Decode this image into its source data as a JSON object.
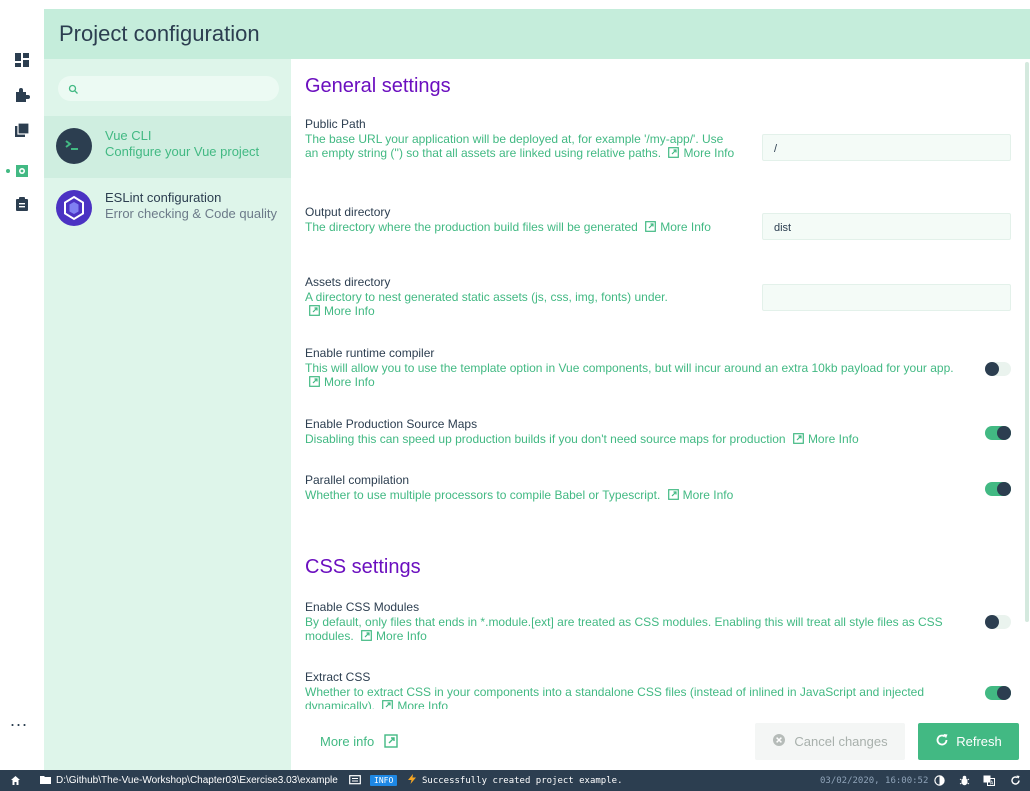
{
  "header": {
    "title": "Project configuration"
  },
  "sidebar": {
    "search": {
      "placeholder": ""
    },
    "items": [
      {
        "name": "Vue CLI",
        "description": "Configure your Vue project",
        "selected": true,
        "icon": "vue-cli-icon"
      },
      {
        "name": "ESLint configuration",
        "description": "Error checking & Code quality",
        "selected": false,
        "icon": "eslint-icon"
      }
    ]
  },
  "nav_rail": {
    "icons": [
      "dashboard-icon",
      "plugins-icon",
      "dependencies-icon",
      "configuration-icon",
      "tasks-icon"
    ],
    "more": "..."
  },
  "general": {
    "title": "General settings",
    "public_path": {
      "label": "Public Path",
      "description": "The base URL your application will be deployed at, for example '/my-app/'. Use an empty string ('') so that all assets are linked using relative paths.",
      "more": "More Info",
      "value": "/"
    },
    "output_dir": {
      "label": "Output directory",
      "description": "The directory where the production build files will be generated",
      "more": "More Info",
      "value": "dist"
    },
    "assets_dir": {
      "label": "Assets directory",
      "description": "A directory to nest generated static assets (js, css, img, fonts) under.",
      "more": "More Info",
      "value": ""
    },
    "runtime_compiler": {
      "label": "Enable runtime compiler",
      "description": "This will allow you to use the template option in Vue components, but will incur around an extra 10kb payload for your app.",
      "more": "More Info",
      "enabled": false
    },
    "source_maps": {
      "label": "Enable Production Source Maps",
      "description": "Disabling this can speed up production builds if you don't need source maps for production",
      "more": "More Info",
      "enabled": true
    },
    "parallel": {
      "label": "Parallel compilation",
      "description": "Whether to use multiple processors to compile Babel or Typescript.",
      "more": "More Info",
      "enabled": true
    }
  },
  "css": {
    "title": "CSS settings",
    "modules": {
      "label": "Enable CSS Modules",
      "description": "By default, only files that ends in *.module.[ext] are treated as CSS modules. Enabling this will treat all style files as CSS modules.",
      "more": "More Info",
      "enabled": false
    },
    "extract": {
      "label": "Extract CSS",
      "description": "Whether to extract CSS in your components into a standalone CSS files (instead of inlined in JavaScript and injected dynamically).",
      "more": "More Info",
      "enabled": true
    }
  },
  "actions": {
    "more_info": "More info",
    "cancel": "Cancel changes",
    "refresh": "Refresh"
  },
  "statusbar": {
    "path": "D:\\Github\\The-Vue-Workshop\\Chapter03\\Exercise3.03\\example",
    "badge": "INFO",
    "message": "Successfully created project example.",
    "timestamp": "03/02/2020, 16:00:52"
  },
  "colors": {
    "accent": "#42b983",
    "title": "#6b0fbf",
    "header_bg": "#c5eddb",
    "sidebar_bg": "#def5ea",
    "statusbar_bg": "#2c3e50"
  }
}
